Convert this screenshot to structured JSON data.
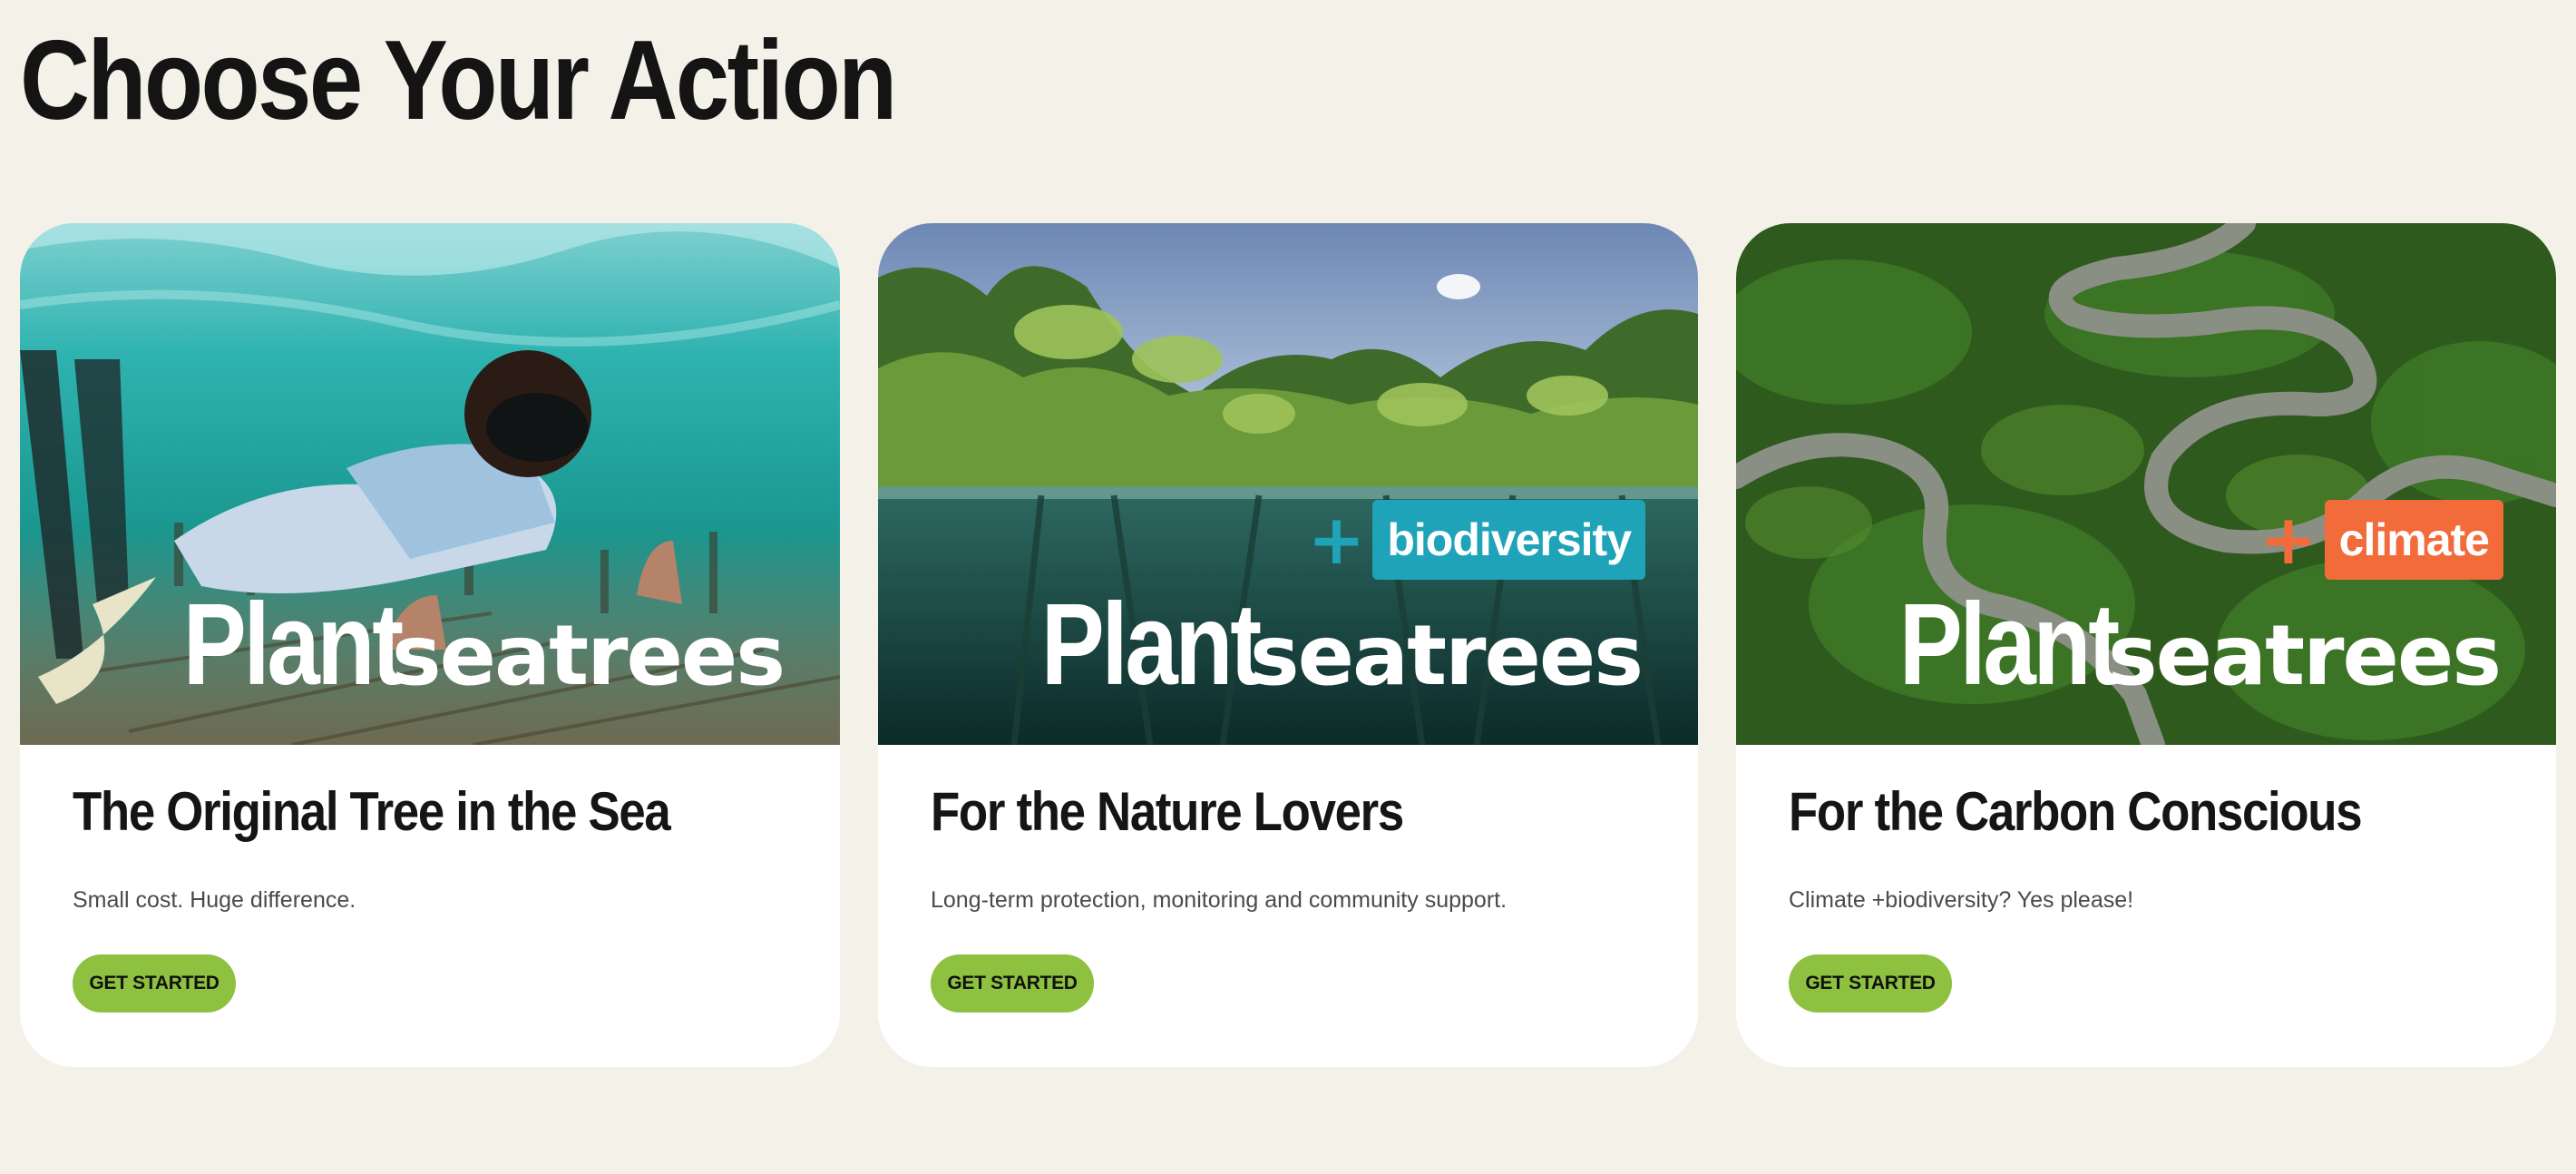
{
  "page": {
    "title": "Choose Your Action"
  },
  "colors": {
    "background": "#f4f1e9",
    "button": "#8dc13f",
    "biodiversity": "#1ea3b8",
    "climate": "#f26b3a"
  },
  "cards": [
    {
      "image_alt": "Snorkeler giving thumbs up over seagrass underwater",
      "wordmark_1": "Plant",
      "wordmark_2": "seatrees",
      "tag_plus": "",
      "tag_label": "",
      "title": "The Original Tree in the Sea",
      "subtitle": "Small cost. Huge difference.",
      "cta": "GET STARTED"
    },
    {
      "image_alt": "Mangrove forest seen half above and half below the water",
      "wordmark_1": "Plant",
      "wordmark_2": "seatrees",
      "tag_plus": "+",
      "tag_label": "biodiversity",
      "title": "For the Nature Lovers",
      "subtitle": "Long-term protection, monitoring and community support.",
      "cta": "GET STARTED"
    },
    {
      "image_alt": "Aerial view of a winding river through dense green forest",
      "wordmark_1": "Plant",
      "wordmark_2": "seatrees",
      "tag_plus": "+",
      "tag_label": "climate",
      "title": "For the Carbon Conscious",
      "subtitle": "Climate +biodiversity? Yes please!",
      "cta": "GET STARTED"
    }
  ]
}
